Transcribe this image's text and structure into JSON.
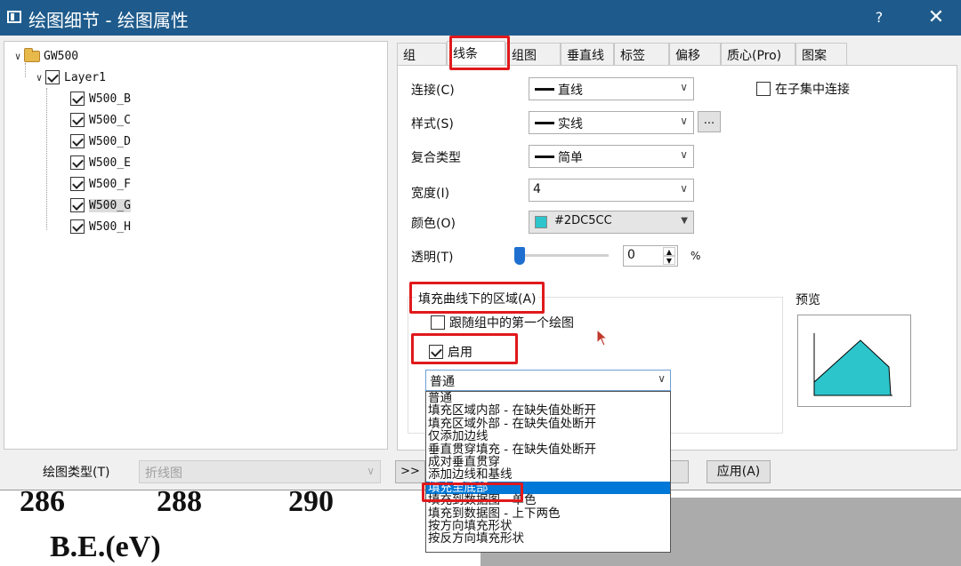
{
  "window": {
    "title": "绘图细节 - 绘图属性",
    "help": "?",
    "close": "✕"
  },
  "tree": {
    "root": "GW500",
    "layer": "Layer1",
    "items": [
      "W500_B",
      "W500_C",
      "W500_D",
      "W500_E",
      "W500_F",
      "W500_G",
      "W500_H"
    ],
    "selected": "W500_G"
  },
  "bottom": {
    "plot_type_label": "绘图类型(T)",
    "plot_type_value": "折线图",
    "more": ">>",
    "apply": "应用(A)"
  },
  "tabs": [
    "组",
    "线条",
    "组图",
    "垂直线",
    "标签",
    "偏移",
    "质心(Pro)",
    "图案"
  ],
  "active_tab": "线条",
  "line": {
    "connect_label": "连接(C)",
    "connect_value": "直线",
    "subset_connect": "在子集中连接",
    "style_label": "样式(S)",
    "style_value": "实线",
    "style_more": "...",
    "compound_label": "复合类型",
    "compound_value": "简单",
    "width_label": "宽度(I)",
    "width_value": "4",
    "color_label": "颜色(O)",
    "color_value": "#2DC5CC",
    "color_swatch": "#2dc5cc",
    "transparency_label": "透明(T)",
    "transparency_value": "0",
    "transparency_unit": "%"
  },
  "fill": {
    "group_label": "填充曲线下的区域(A)",
    "follow_first": "跟随组中的第一个绘图",
    "enable": "启用",
    "selected": "普通",
    "options": [
      "普通",
      "填充区域内部 - 在缺失值处断开",
      "填充区域外部 - 在缺失值处断开",
      "仅添加边线",
      "垂直贯穿填充 - 在缺失值处断开",
      "成对垂直贯穿",
      "添加边线和基线",
      "填充至底部",
      "填充到数据图 - 单色",
      "填充到数据图 - 上下两色",
      "按方向填充形状",
      "按反方向填充形状"
    ],
    "highlighted": "填充至底部"
  },
  "preview": {
    "label": "预览",
    "fill_color": "#2dc5cc"
  },
  "background": {
    "ticks": [
      "286",
      "288",
      "290"
    ],
    "axis_label": "B.E.(eV)"
  }
}
